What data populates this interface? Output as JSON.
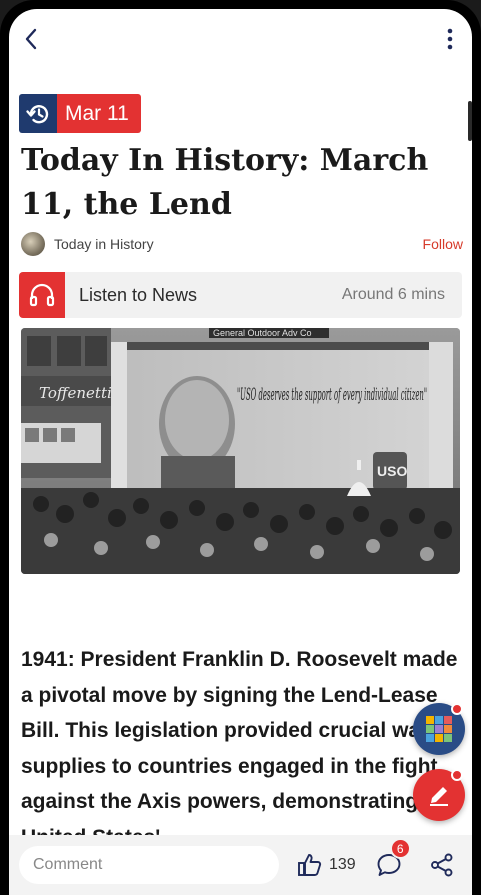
{
  "header": {
    "back_icon": "chevron-left-icon",
    "more_icon": "vertical-dots-icon"
  },
  "article": {
    "date_tag": "Mar 11",
    "date_icon": "history-icon",
    "title": "Today In History: March 11, the Lend",
    "author": "Today in History",
    "follow_label": "Follow",
    "listen_label": "Listen to News",
    "listen_duration": "Around 6 mins",
    "listen_icon": "headphones-icon",
    "image": {
      "banner_text": "\"USO deserves the support of every individual citizen\"",
      "sign_text": "General Outdoor Adv Co",
      "shield_text": "USO",
      "store_sign": "Toffenetti"
    },
    "body": "1941: President Franklin D. Roosevelt made a pivotal move by signing the Lend-Lease Bill. This legislation provided crucial war supplies to countries engaged in the fight against the Axis powers, demonstrating the United States'"
  },
  "fabs": {
    "grid_icon": "grid-icon",
    "edit_icon": "pencil-icon"
  },
  "bottom_bar": {
    "comment_placeholder": "Comment",
    "like_count": "139",
    "comment_count": "6",
    "like_icon": "thumbs-up-icon",
    "comment_icon": "chat-bubble-icon",
    "share_icon": "share-icon"
  },
  "colors": {
    "accent_red": "#e33232",
    "navy": "#1f3a6e"
  }
}
